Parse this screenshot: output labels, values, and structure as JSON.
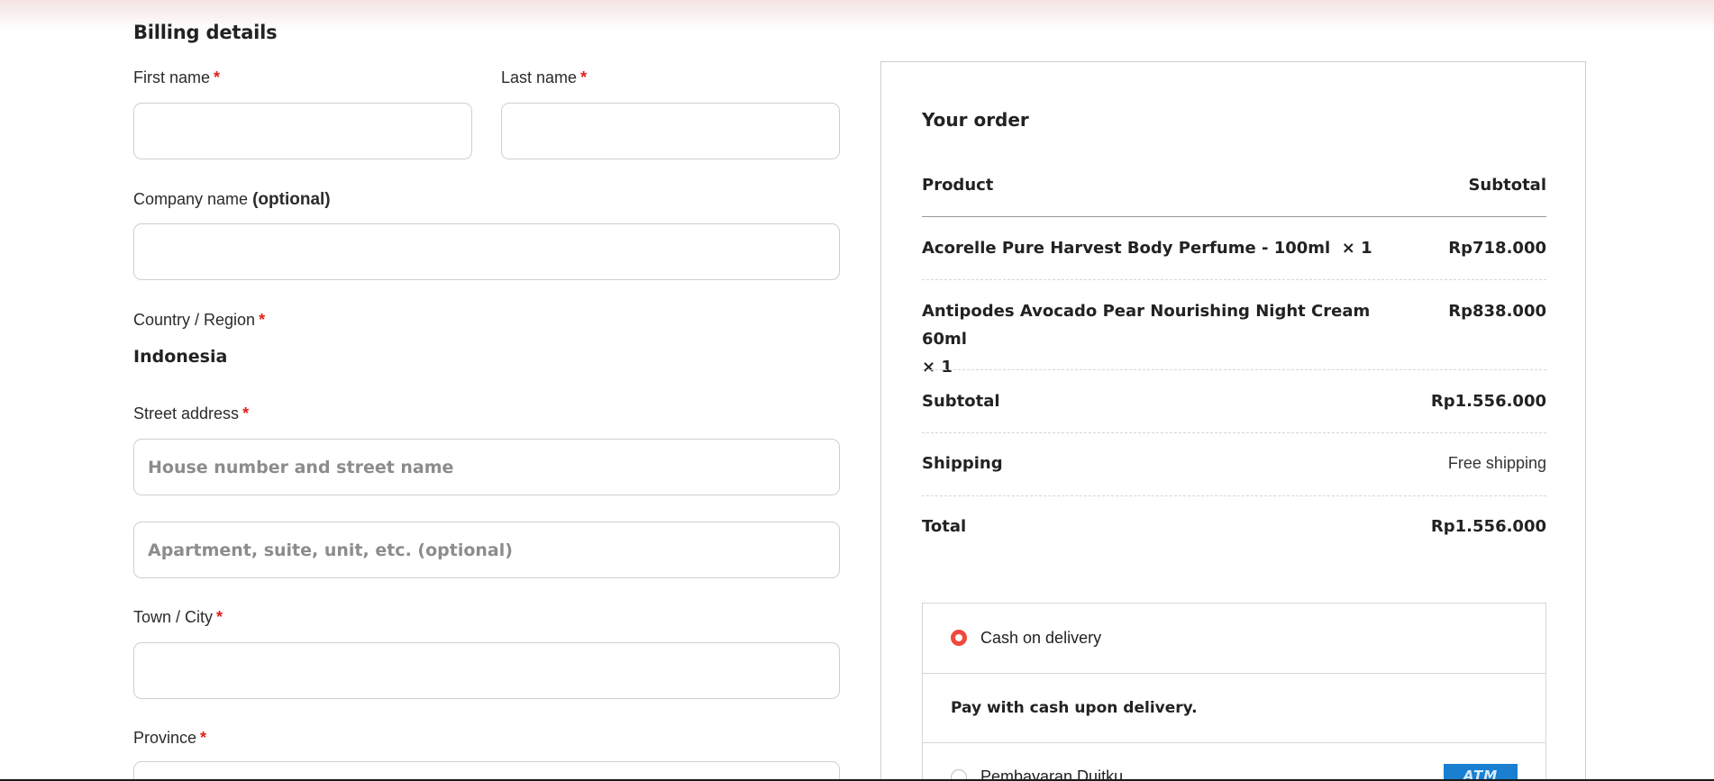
{
  "billing": {
    "title": "Billing details",
    "first_name_label": "First name",
    "last_name_label": "Last name",
    "company_label": "Company name",
    "company_optional": "(optional)",
    "country_label": "Country / Region",
    "country_value": "Indonesia",
    "street_label": "Street address",
    "street_placeholder": "House number and street name",
    "apartment_placeholder": "Apartment, suite, unit, etc. (optional)",
    "city_label": "Town / City",
    "province_label": "Province",
    "required_mark": "*",
    "first_name_value": "",
    "last_name_value": "",
    "company_value": "",
    "street_value": "",
    "apartment_value": "",
    "city_value": ""
  },
  "order": {
    "title": "Your order",
    "header_product": "Product",
    "header_subtotal": "Subtotal",
    "items": [
      {
        "name": "Acorelle Pure Harvest Body Perfume - 100ml",
        "qty": "× 1",
        "price": "Rp718.000"
      },
      {
        "name": "Antipodes Avocado Pear Nourishing Night Cream 60ml",
        "qty": "× 1",
        "price": "Rp838.000"
      }
    ],
    "subtotal_label": "Subtotal",
    "subtotal_value": "Rp1.556.000",
    "shipping_label": "Shipping",
    "shipping_value": "Free shipping",
    "total_label": "Total",
    "total_value": "Rp1.556.000"
  },
  "payment": {
    "options": [
      {
        "label": "Cash on delivery",
        "selected": true,
        "description": "Pay with cash upon delivery."
      },
      {
        "label": "Pembayaran Duitku",
        "selected": false,
        "badge": "ATM"
      }
    ]
  },
  "colors": {
    "required": "#e0201b",
    "radio_selected": "#f0493e",
    "atm_badge": "#1a7fd1"
  }
}
